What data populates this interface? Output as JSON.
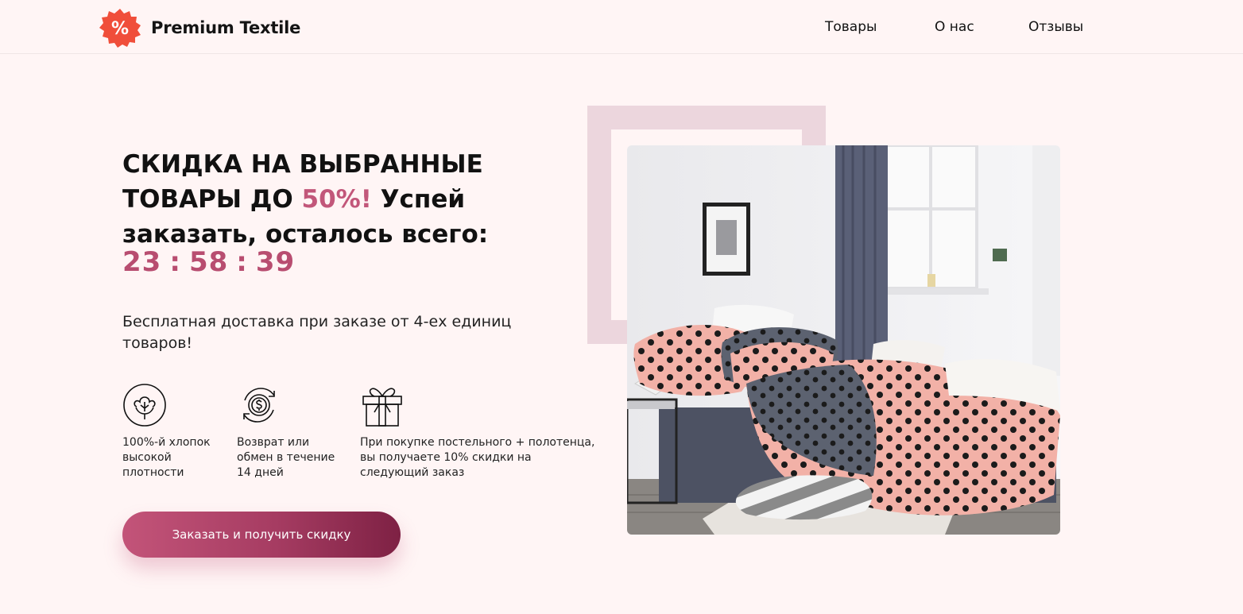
{
  "brand": {
    "name": "Premium Textile",
    "badge_symbol": "%"
  },
  "nav": [
    "Товары",
    "О нас",
    "Отзывы"
  ],
  "hero": {
    "headline_part1": "СКИДКА НА ВЫБРАННЫЕ ТОВАРЫ ДО ",
    "headline_accent": "50%!",
    "headline_part2": " Успей заказать, осталось всего:",
    "timer": {
      "hours": "23",
      "minutes": "58",
      "seconds": "39",
      "separator": ":"
    },
    "subtitle": "Бесплатная доставка при заказе от 4-ех единиц товаров!"
  },
  "features": [
    {
      "icon": "cotton-icon",
      "text": "100%-й хлопок высокой плотности"
    },
    {
      "icon": "money-exchange-icon",
      "text": "Возврат или обмен в течение 14 дней"
    },
    {
      "icon": "gift-icon",
      "text": "При покупке постельного + полотенца, вы получаете 10% скидки на следующий заказ"
    }
  ],
  "cta": {
    "label": "Заказать и получить скидку"
  },
  "colors": {
    "accent": "#c2577a",
    "background": "#fff5f5",
    "logo_badge": "#f04e3a",
    "frame": "#ecd6dd"
  }
}
